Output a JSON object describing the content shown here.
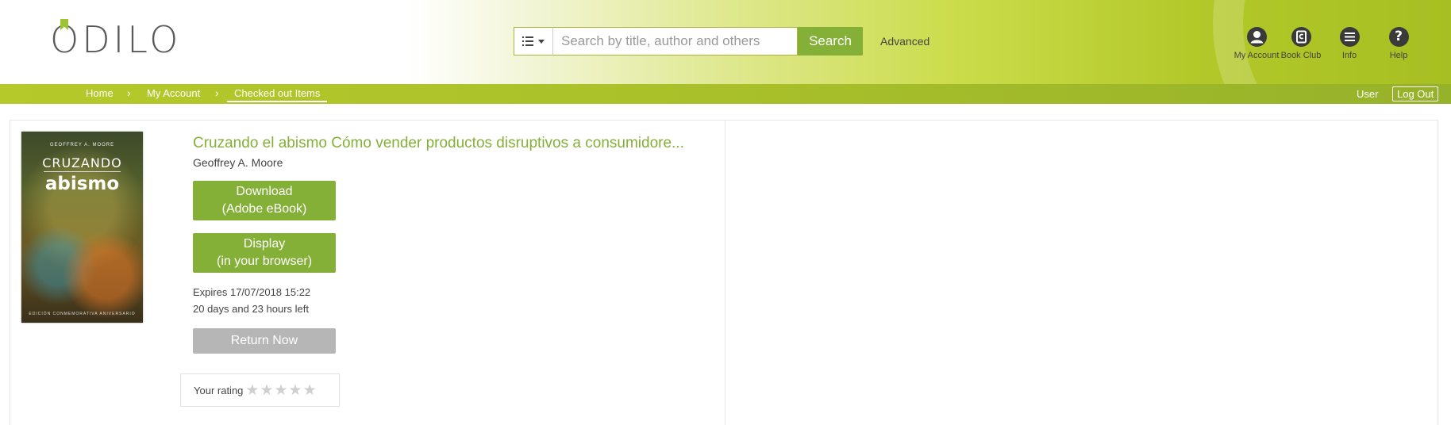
{
  "brand": {
    "logo_text": "ODILO",
    "accent": "#84b038"
  },
  "search": {
    "type_icon": "list-icon",
    "placeholder": "Search by title, author and others",
    "value": "",
    "button_label": "Search",
    "advanced_label": "Advanced"
  },
  "top_nav": {
    "items": [
      {
        "label": "My Account",
        "icon": "user-icon"
      },
      {
        "label": "Book Club",
        "icon": "book-club-icon"
      },
      {
        "label": "Info",
        "icon": "menu-icon"
      },
      {
        "label": "Help",
        "icon": "help-icon"
      }
    ]
  },
  "breadcrumb": {
    "items": [
      "Home",
      "My Account",
      "Checked out Items"
    ],
    "user_label": "User",
    "logout_label": "Log Out"
  },
  "item": {
    "cover": {
      "author": "GEOFFREY A. MOORE",
      "title_line1": "CRUZANDO",
      "title_line2": "abismo",
      "footer": "EDICIÓN CONMEMORATIVA ANIVERSARIO"
    },
    "title": "Cruzando el abismo Cómo vender productos disruptivos a consumidore...",
    "author": "Geoffrey A. Moore",
    "download": {
      "line1": "Download",
      "line2": "(Adobe eBook)"
    },
    "display": {
      "line1": "Display",
      "line2": "(in your browser)"
    },
    "expires": "Expires 17/07/2018 15:22",
    "time_left": "20 days and 23 hours left",
    "return_label": "Return Now",
    "rating": {
      "label": "Your rating",
      "value": 0,
      "max": 5
    }
  }
}
